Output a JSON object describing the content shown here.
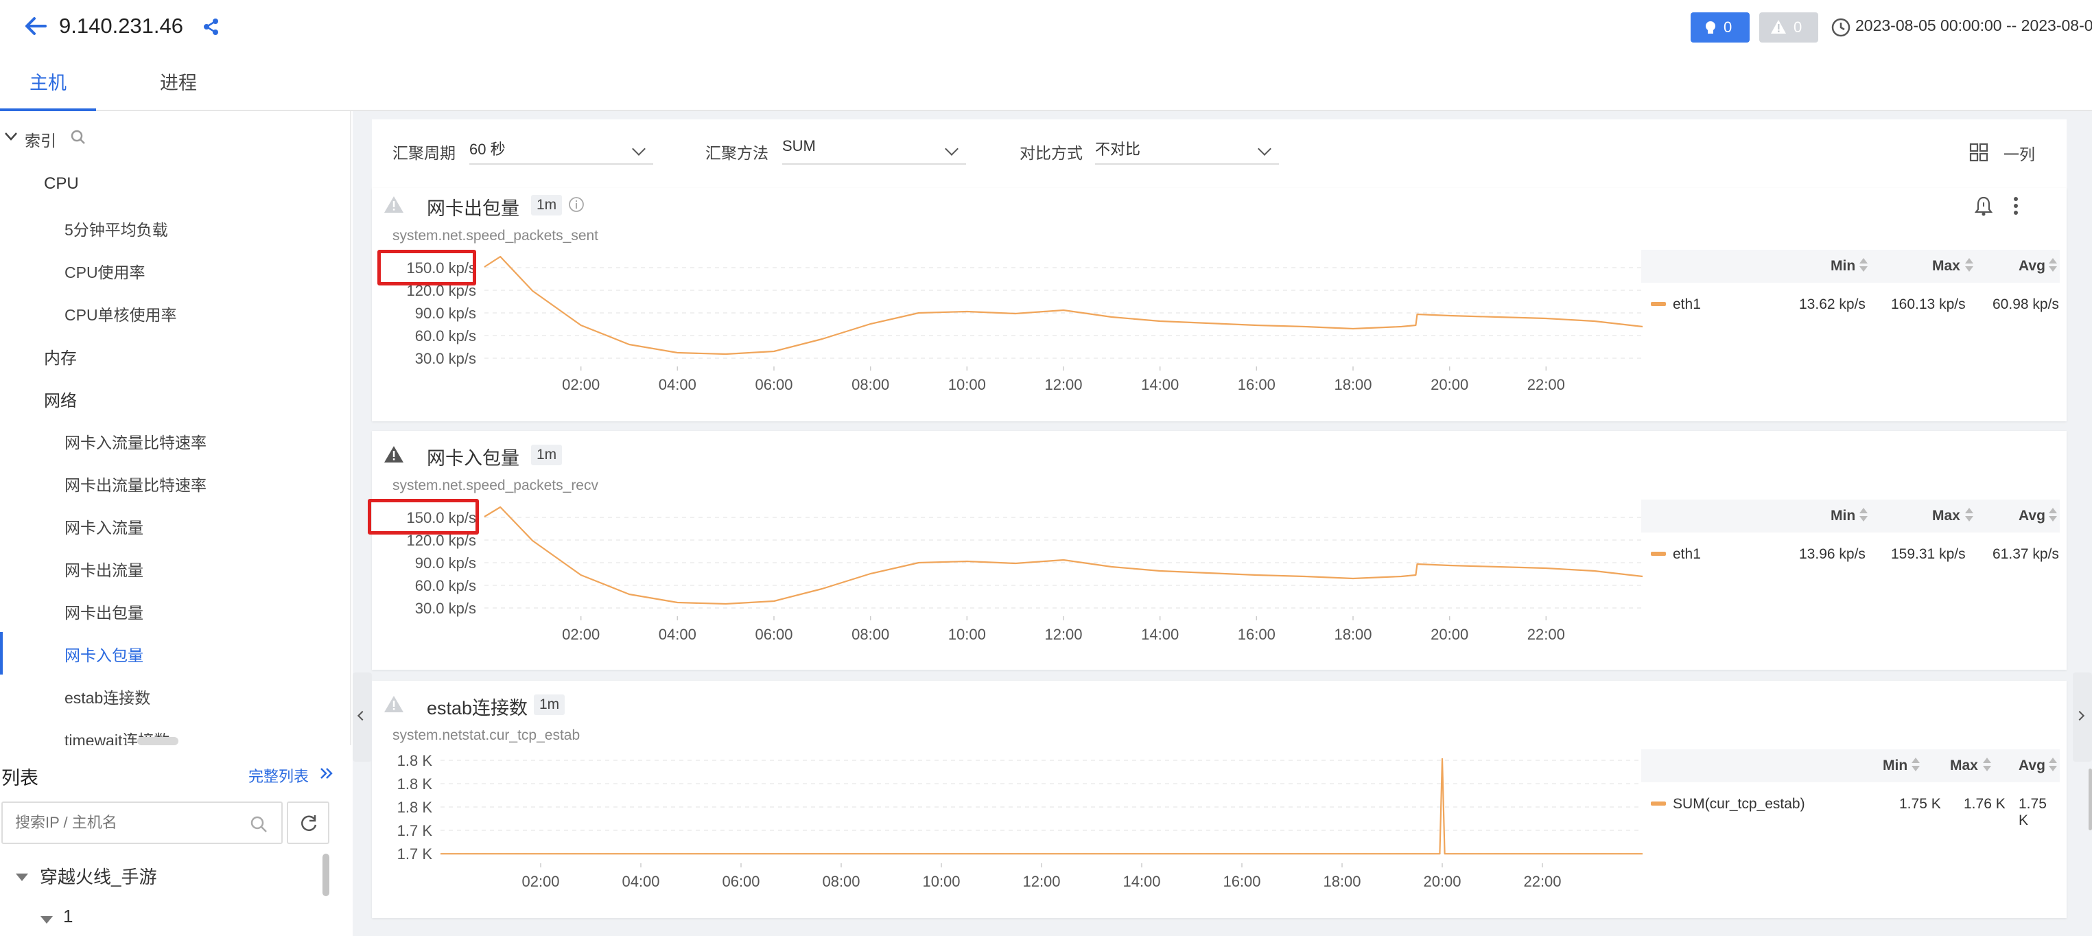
{
  "header": {
    "title": "9.140.231.46",
    "badge_alert_count": "0",
    "badge_warn_count": "0",
    "time_range": "2023-08-05 00:00:00 -- 2023-08-0"
  },
  "tabs": [
    {
      "label": "主机",
      "active": true
    },
    {
      "label": "进程",
      "active": false
    }
  ],
  "sidebar": {
    "index_label": "索引",
    "items": [
      {
        "label": "CPU",
        "level": 1
      },
      {
        "label": "5分钟平均负载",
        "level": 2
      },
      {
        "label": "CPU使用率",
        "level": 2
      },
      {
        "label": "CPU单核使用率",
        "level": 2
      },
      {
        "label": "内存",
        "level": 1
      },
      {
        "label": "网络",
        "level": 1
      },
      {
        "label": "网卡入流量比特速率",
        "level": 2
      },
      {
        "label": "网卡出流量比特速率",
        "level": 2
      },
      {
        "label": "网卡入流量",
        "level": 2
      },
      {
        "label": "网卡出流量",
        "level": 2
      },
      {
        "label": "网卡出包量",
        "level": 2
      },
      {
        "label": "网卡入包量",
        "level": 2,
        "active": true
      },
      {
        "label": "estab连接数",
        "level": 2
      },
      {
        "label": "timewait连接数",
        "level": 2
      }
    ],
    "list_title": "列表",
    "full_list_link": "完整列表",
    "search_placeholder": "搜索IP / 主机名",
    "groups": [
      {
        "label": "穿越火线_手游"
      },
      {
        "label": "1"
      }
    ]
  },
  "filters": {
    "period_label": "汇聚周期",
    "period_value": "60 秒",
    "method_label": "汇聚方法",
    "method_value": "SUM",
    "compare_label": "对比方式",
    "compare_value": "不对比",
    "layout_label": "一列"
  },
  "panels": [
    {
      "title": "网卡出包量",
      "interval": "1m",
      "metric": "system.net.speed_packets_sent",
      "legend": {
        "headers": [
          "Min",
          "Max",
          "Avg"
        ],
        "rows": [
          {
            "name": "eth1",
            "min": "13.62 kp/s",
            "max": "160.13 kp/s",
            "avg": "60.98 kp/s",
            "color": "#f0a55a"
          }
        ]
      }
    },
    {
      "title": "网卡入包量",
      "interval": "1m",
      "metric": "system.net.speed_packets_recv",
      "legend": {
        "headers": [
          "Min",
          "Max",
          "Avg"
        ],
        "rows": [
          {
            "name": "eth1",
            "min": "13.96 kp/s",
            "max": "159.31 kp/s",
            "avg": "61.37 kp/s",
            "color": "#f0a55a"
          }
        ]
      }
    },
    {
      "title": "estab连接数",
      "interval": "1m",
      "metric": "system.netstat.cur_tcp_estab",
      "legend": {
        "headers": [
          "Min",
          "Max",
          "Avg"
        ],
        "rows": [
          {
            "name": "SUM(cur_tcp_estab)",
            "min": "1.75 K",
            "max": "1.76 K",
            "avg": "1.75 K",
            "color": "#f0a55a"
          }
        ]
      }
    }
  ],
  "chart_data": [
    {
      "type": "line",
      "title": "网卡出包量",
      "ytick_labels": [
        "150.0 kp/s",
        "120.0 kp/s",
        "90.0 kp/s",
        "60.0 kp/s",
        "30.0 kp/s"
      ],
      "xtick_labels": [
        "02:00",
        "04:00",
        "06:00",
        "08:00",
        "10:00",
        "12:00",
        "14:00",
        "16:00",
        "18:00",
        "20:00",
        "22:00"
      ],
      "series": [
        {
          "name": "eth1",
          "x": [
            0.0,
            0.33,
            1,
            2,
            3,
            4,
            5,
            6,
            7,
            8,
            9,
            10,
            11,
            12,
            13,
            14,
            15,
            16,
            17,
            18,
            19,
            19.3,
            19.33,
            20,
            21,
            22,
            23,
            24
          ],
          "y": [
            145,
            160,
            110,
            60,
            32,
            20,
            18,
            22,
            40,
            62,
            78,
            80,
            77,
            82,
            72,
            66,
            63,
            60,
            58,
            55,
            58,
            60,
            76,
            74,
            72,
            70,
            66,
            58
          ]
        }
      ],
      "ylim": [
        0,
        170
      ]
    },
    {
      "type": "line",
      "title": "网卡入包量",
      "ytick_labels": [
        "150.0 kp/s",
        "120.0 kp/s",
        "90.0 kp/s",
        "60.0 kp/s",
        "30.0 kp/s"
      ],
      "xtick_labels": [
        "02:00",
        "04:00",
        "06:00",
        "08:00",
        "10:00",
        "12:00",
        "14:00",
        "16:00",
        "18:00",
        "20:00",
        "22:00"
      ],
      "series": [
        {
          "name": "eth1",
          "x": [
            0.0,
            0.33,
            1,
            2,
            3,
            4,
            5,
            6,
            7,
            8,
            9,
            10,
            11,
            12,
            13,
            14,
            15,
            16,
            17,
            18,
            19,
            19.3,
            19.33,
            20,
            21,
            22,
            23,
            24
          ],
          "y": [
            145,
            159,
            110,
            60,
            32,
            20,
            18,
            22,
            40,
            62,
            78,
            80,
            77,
            82,
            72,
            66,
            63,
            60,
            58,
            55,
            58,
            60,
            76,
            74,
            72,
            70,
            66,
            58
          ]
        }
      ],
      "ylim": [
        0,
        170
      ]
    },
    {
      "type": "line",
      "title": "estab连接数",
      "ytick_labels": [
        "1.8 K",
        "1.8 K",
        "1.8 K",
        "1.7 K",
        "1.7 K"
      ],
      "xtick_labels": [
        "02:00",
        "04:00",
        "06:00",
        "08:00",
        "10:00",
        "12:00",
        "14:00",
        "16:00",
        "18:00",
        "20:00",
        "22:00"
      ],
      "series": [
        {
          "name": "SUM(cur_tcp_estab)",
          "x": [
            0,
            19.95,
            20.0,
            20.05,
            24
          ],
          "y": [
            1750,
            1750,
            1760,
            1750,
            1750
          ]
        }
      ],
      "ylim": [
        1749,
        1761
      ]
    }
  ]
}
